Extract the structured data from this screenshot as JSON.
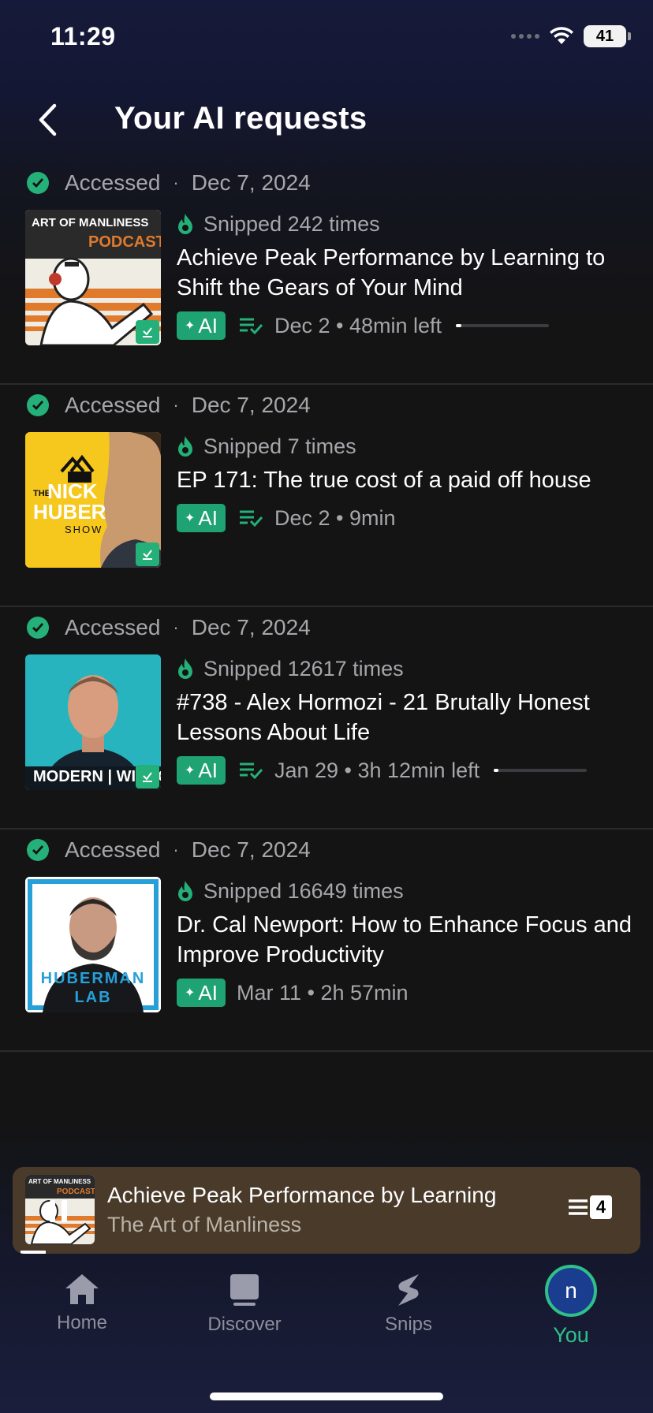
{
  "status_bar": {
    "time": "11:29",
    "battery": "41"
  },
  "header": {
    "title": "Your AI requests"
  },
  "items": [
    {
      "accessed_label": "Accessed",
      "accessed_sep": "·",
      "accessed_date": "Dec 7, 2024",
      "snipped": "Snipped 242 times",
      "title": "Achieve Peak Performance by Learning to Shift the Gears of Your Mind",
      "ai_label": "AI",
      "meta": "Dec 2 • 48min left",
      "progress": 0.06,
      "thumb": {
        "line1": "ART OF MANLINESS",
        "line2": "PODCAST"
      }
    },
    {
      "accessed_label": "Accessed",
      "accessed_sep": "·",
      "accessed_date": "Dec 7, 2024",
      "snipped": "Snipped 7 times",
      "title": "EP 171: The true cost of a paid off house",
      "ai_label": "AI",
      "meta": "Dec 2 • 9min",
      "thumb": {
        "line1": "THE",
        "line2": "NICK",
        "line3": "HUBER",
        "line4": "SHOW"
      }
    },
    {
      "accessed_label": "Accessed",
      "accessed_sep": "·",
      "accessed_date": "Dec 7, 2024",
      "snipped": "Snipped 12617 times",
      "title": "#738 - Alex Hormozi - 21 Brutally Honest Lessons About Life",
      "ai_label": "AI",
      "meta": "Jan 29 • 3h 12min left",
      "progress": 0.04,
      "thumb": {
        "line1": "MODERN | WISDOM"
      }
    },
    {
      "accessed_label": "Accessed",
      "accessed_sep": "·",
      "accessed_date": "Dec 7, 2024",
      "snipped": "Snipped 16649 times",
      "title": "Dr. Cal Newport: How to Enhance Focus and Improve Productivity",
      "ai_label": "AI",
      "meta": "Mar 11 • 2h 57min",
      "thumb": {
        "line1": "HUBERMAN",
        "line2": "LAB"
      }
    }
  ],
  "mini_player": {
    "title": "Achieve Peak Performance by Learning",
    "subtitle": "The Art of Manliness",
    "queue_count": "4",
    "thumb": {
      "line1": "ART OF MANLINESS",
      "line2": "PODCAST"
    }
  },
  "tabs": [
    {
      "label": "Home"
    },
    {
      "label": "Discover"
    },
    {
      "label": "Snips"
    },
    {
      "label": "You",
      "avatar": "n"
    }
  ],
  "colors": {
    "accent": "#24b078",
    "tab_active": "#2fc08a",
    "player_bg": "#4a3a2a"
  }
}
